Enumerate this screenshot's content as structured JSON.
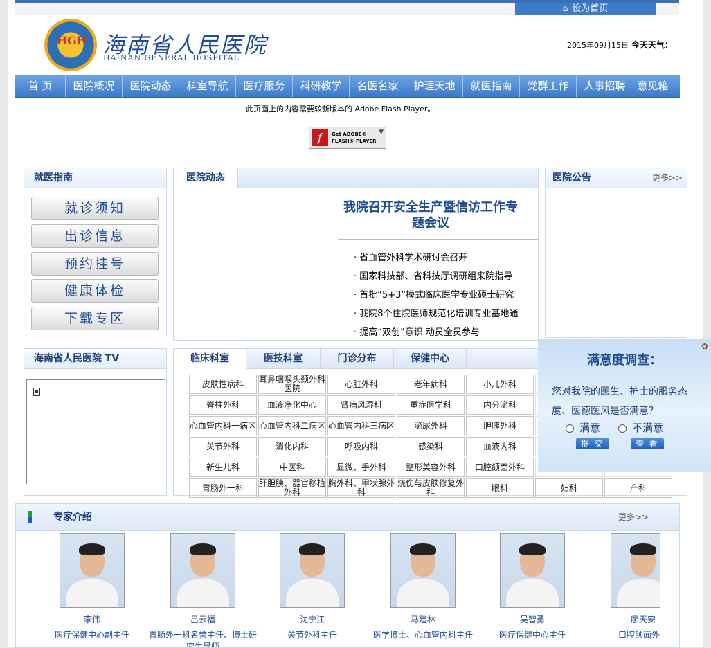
{
  "header": {
    "set_home": "设为首页",
    "hospital_name_cn": "海南省人民医院",
    "hospital_name_en": "HAINAN GENERAL HOSPITAL",
    "logo_text": "HGH",
    "date": "2015年09月15日",
    "weather_label": "今天天气："
  },
  "nav": {
    "items": [
      "首 页",
      "医院概况",
      "医院动态",
      "科室导航",
      "医疗服务",
      "科研教学",
      "名医名家",
      "护理天地",
      "就医指南",
      "党群工作",
      "人事招聘",
      "意见箱"
    ]
  },
  "flash": {
    "message": "此页面上的内容需要较新版本的 Adobe Flash Player。",
    "button_line1": "Get ADOBE®",
    "button_line2": "FLASH® PLAYER"
  },
  "guide": {
    "title": "就医指南",
    "buttons": [
      "就诊须知",
      "出诊信息",
      "预约挂号",
      "健康体检",
      "下载专区"
    ]
  },
  "news": {
    "tab": "医院动态",
    "headline": "我院召开安全生产暨信访工作专题会议",
    "items": [
      "省血管外科学术研讨会召开",
      "国家科技部、省科技厅调研组来院指导",
      "首批“5+3”模式临床医学专业硕士研究",
      "我院8个住院医师规范化培训专业基地通",
      "提高“双创”意识 动员全员参与"
    ]
  },
  "notice": {
    "title": "医院公告",
    "more": "更多>>"
  },
  "tv": {
    "title": "海南省人民医院 TV"
  },
  "departments": {
    "tabs": [
      "临床科室",
      "医技科室",
      "门诊分布",
      "保健中心"
    ],
    "cells": [
      "皮肤性病科",
      "耳鼻咽喉头颈外科医院",
      "心脏外科",
      "老年病科",
      "小儿外科",
      "",
      "",
      "脊柱外科",
      "血液净化中心",
      "肾病风湿科",
      "重症医学科",
      "内分泌科",
      "",
      "",
      "心血管内科一病区",
      "心血管内科二病区",
      "心血管内科三病区",
      "泌尿外科",
      "胆胰外科",
      "",
      "",
      "关节外科",
      "消化内科",
      "呼吸内科",
      "感染科",
      "血液内科",
      "",
      "",
      "新生儿科",
      "中医科",
      "显微、手外科",
      "整形美容外科",
      "口腔颌面外科",
      "",
      "",
      "胃肠外一科",
      "肝胆胰、器官移植外科",
      "胸外科、甲状腺外科",
      "烧伤与皮肤修复外科",
      "眼科",
      "妇科",
      "产科"
    ]
  },
  "survey": {
    "title": "满意度调查：",
    "question": "您对我院的医生、护士的服务态度、医德医风是否满意？",
    "option_yes": "满意",
    "option_no": "不满意",
    "submit": "提 交",
    "view": "查 看"
  },
  "experts": {
    "title": "专家介绍",
    "more": "更多>>",
    "list": [
      {
        "name": "李伟",
        "title": "医疗保健中心副主任"
      },
      {
        "name": "吕云福",
        "title": "胃肠外一科名誉主任、博士研究生导师"
      },
      {
        "name": "沈宁江",
        "title": "关节外科主任"
      },
      {
        "name": "马建林",
        "title": "医学博士、心血管内科主任"
      },
      {
        "name": "吴智勇",
        "title": "医疗保健中心主任"
      },
      {
        "name": "廖天安",
        "title": "口腔颌面外科"
      }
    ]
  }
}
